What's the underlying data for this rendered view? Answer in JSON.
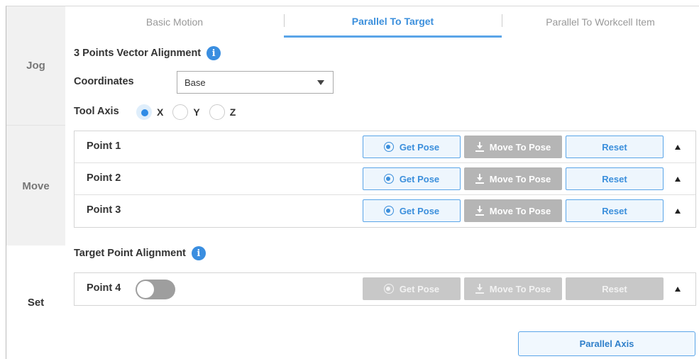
{
  "sidebar": {
    "items": [
      {
        "label": "Jog"
      },
      {
        "label": "Move"
      },
      {
        "label": "Set"
      }
    ]
  },
  "tabs": [
    {
      "label": "Basic Motion"
    },
    {
      "label": "Parallel To Target"
    },
    {
      "label": "Parallel To Workcell Item"
    }
  ],
  "section1": {
    "title": "3 Points Vector Alignment",
    "info_glyph": "i",
    "coordinates_label": "Coordinates",
    "coordinates_value": "Base",
    "tool_axis_label": "Tool Axis",
    "axes": [
      {
        "label": "X",
        "checked": true
      },
      {
        "label": "Y",
        "checked": false
      },
      {
        "label": "Z",
        "checked": false
      }
    ],
    "points": [
      {
        "label": "Point 1",
        "get": "Get Pose",
        "move": "Move To Pose",
        "reset": "Reset"
      },
      {
        "label": "Point 2",
        "get": "Get Pose",
        "move": "Move To Pose",
        "reset": "Reset"
      },
      {
        "label": "Point 3",
        "get": "Get Pose",
        "move": "Move To Pose",
        "reset": "Reset"
      }
    ]
  },
  "section2": {
    "title": "Target Point Alignment",
    "info_glyph": "i",
    "point": {
      "label": "Point 4",
      "get": "Get Pose",
      "move": "Move To Pose",
      "reset": "Reset",
      "enabled": false
    }
  },
  "footer": {
    "parallel_axis": "Parallel Axis"
  },
  "colors": {
    "accent": "#3b8fdc",
    "info": "#3a8ee0",
    "disabled": "#c8c8c8"
  }
}
